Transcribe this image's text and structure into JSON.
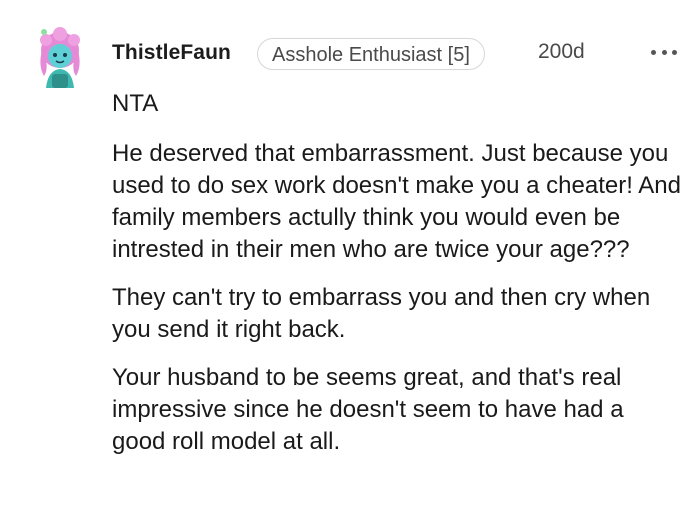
{
  "comment": {
    "username": "ThistleFaun",
    "flair": "Asshole Enthusiast [5]",
    "age": "200d",
    "more_icon": "more-horizontal-icon",
    "avatar_icon": "user-avatar-icon",
    "paragraphs": [
      "NTA",
      "He deserved that embarrassment. Just because you used to do sex work doesn't make you a cheater! And family members actully think you would even be intrested in their men who are twice your age???",
      "They can't try to embarrass you and then cry when you send it right back.",
      "Your husband to be seems great, and that's real impressive since he doesn't seem to have had a good roll model at all."
    ]
  },
  "colors": {
    "background": "#ffffff",
    "text": "#1a1a1b",
    "meta": "#4a4a4a",
    "flair_border": "#d7d7d7",
    "avatar_hair": "#e58ad6",
    "avatar_face": "#5fd0d6"
  }
}
